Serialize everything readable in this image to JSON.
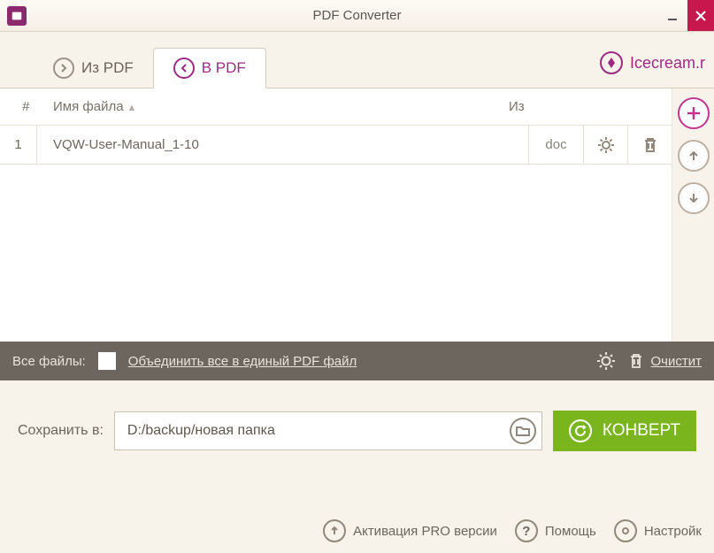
{
  "titlebar": {
    "title": "PDF Converter"
  },
  "tabs": {
    "from_pdf": "Из PDF",
    "to_pdf": "В PDF"
  },
  "brand": "Icecream.r",
  "table": {
    "col_num": "#",
    "col_name": "Имя файла",
    "col_from": "Из",
    "rows": [
      {
        "num": "1",
        "name": "VQW-User-Manual_1-10",
        "ext": "doc"
      }
    ]
  },
  "allfiles": {
    "label": "Все файлы:",
    "merge": "Объединить все в единый PDF файл",
    "clear": "Очистит"
  },
  "save": {
    "label": "Сохранить в:",
    "path": "D:/backup/новая папка"
  },
  "convert": "КОНВЕРТ",
  "footer": {
    "pro": "Активация PRO версии",
    "help": "Помощь",
    "settings": "Настройк"
  }
}
